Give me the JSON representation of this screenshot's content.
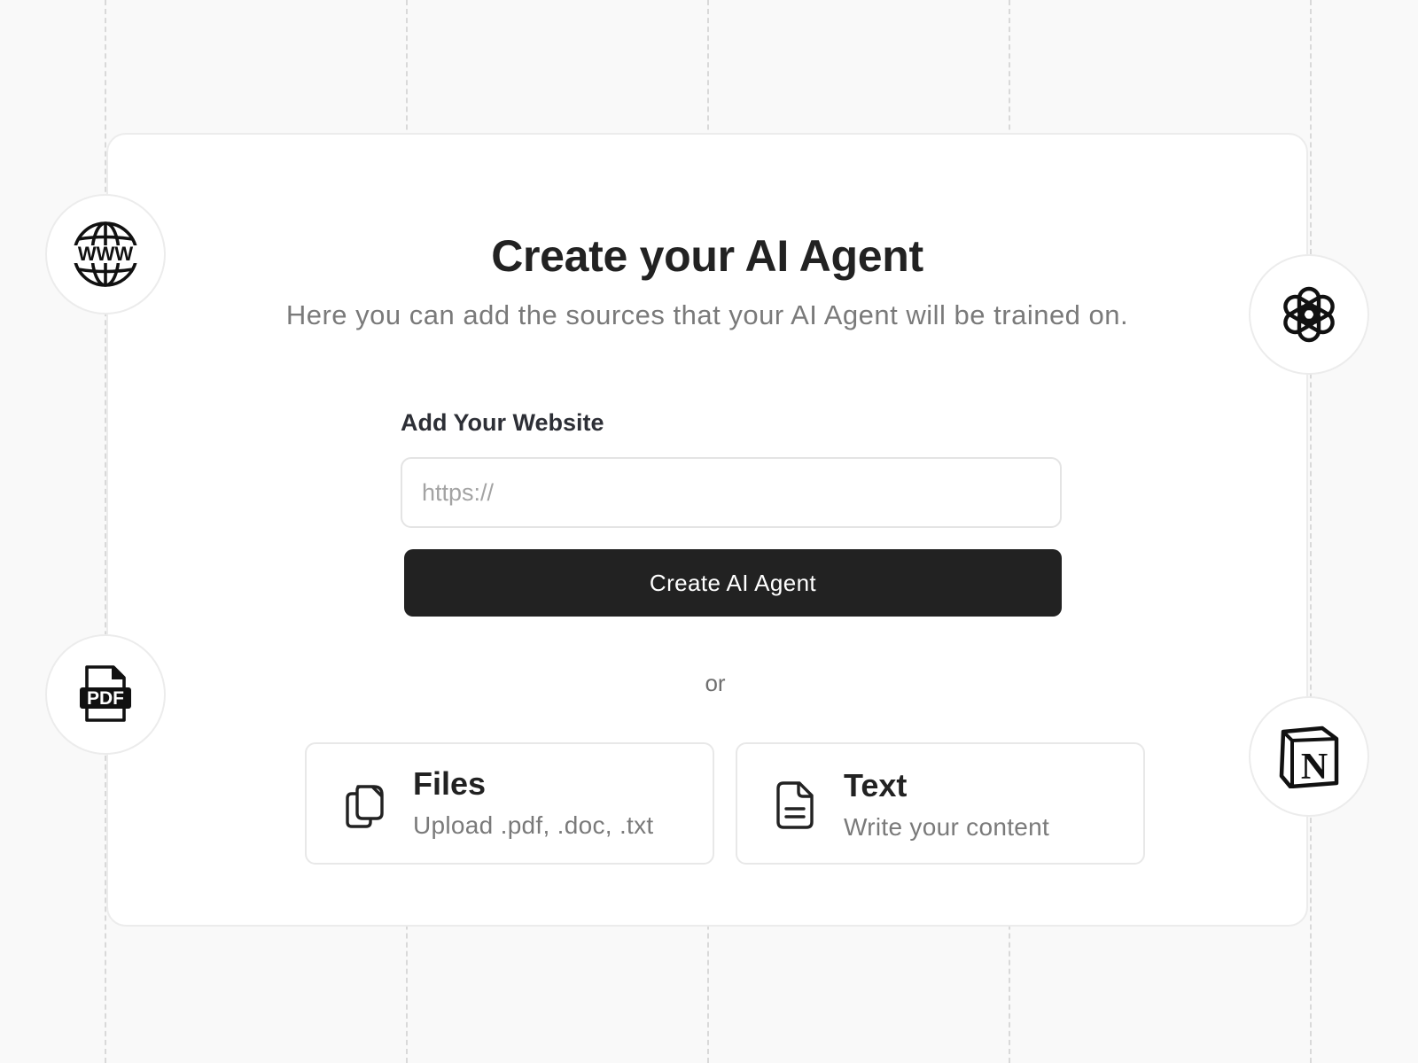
{
  "header": {
    "title": "Create your AI Agent",
    "subtitle": "Here you can add the sources that your AI Agent will be trained on."
  },
  "website_form": {
    "label": "Add Your Website",
    "url_placeholder": "https://",
    "url_value": "",
    "submit_label": "Create AI Agent"
  },
  "divider": {
    "text": "or"
  },
  "options": [
    {
      "title": "Files",
      "description": "Upload .pdf, .doc, .txt",
      "icon": "files-icon"
    },
    {
      "title": "Text",
      "description": "Write your content",
      "icon": "document-icon"
    }
  ],
  "source_badges": [
    {
      "icon": "www-globe-icon",
      "text": "WWW"
    },
    {
      "icon": "pdf-file-icon",
      "text": "PDF"
    },
    {
      "icon": "openai-logo-icon"
    },
    {
      "icon": "notion-logo-icon",
      "text": "N"
    }
  ],
  "colors": {
    "background": "#f9f9f9",
    "card": "#ffffff",
    "button": "#222222",
    "button_text": "#ffffff",
    "muted_text": "#7a7a7a"
  }
}
